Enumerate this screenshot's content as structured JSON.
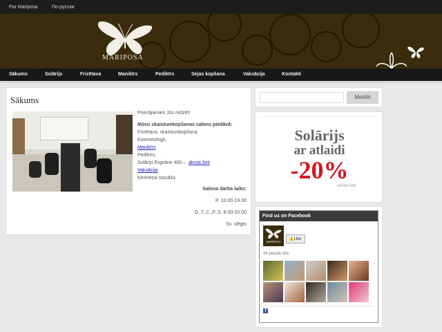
{
  "topbar": {
    "links": [
      "Par Mariposa",
      "По-русски"
    ]
  },
  "header": {
    "logo_text": "MARIPOSA"
  },
  "nav": {
    "items": [
      "Sākums",
      "Solārijs",
      "Frizētava",
      "Manikīrs",
      "Pedikīrs",
      "Sejas kopšana",
      "Vaksācija",
      "Kontakti"
    ]
  },
  "main": {
    "title": "Sākums",
    "greeting": "Priecājamies Jūs redzēt!",
    "services_heading": "Mūsu skaistumkopšanas salons piedāvā:",
    "services": [
      "Frizētava, skaistumkopšana.",
      "Kosmetologs.",
      "Manikīrs",
      "Pedikīrs.",
      "Solārijs Ergoline 400 –",
      "akcija šeit",
      "Vaksācija",
      "Ķermeņa masāža"
    ],
    "hours_heading": "Salona darba laiks:",
    "hours": [
      "P. 10.00-19.00",
      "O.,T.,C.,P.,S. 8.00-20.00",
      "Sv. slēgts"
    ]
  },
  "search": {
    "placeholder": "",
    "button_label": "Meklēt"
  },
  "promo": {
    "line1": "Solārijs",
    "line2": "ar atlaidi",
    "discount": "-20%",
    "caption": "cenas šeit"
  },
  "facebook": {
    "title": "Find us on Facebook",
    "page_name": "MARIPOSA",
    "like_label": "Like",
    "people_like": "44 people like"
  },
  "colors": {
    "brand_brown": "#3a2c0d",
    "nav_bg": "#181818",
    "promo_red": "#d8141d",
    "promo_title": "#666666",
    "link": "#2222bb"
  }
}
